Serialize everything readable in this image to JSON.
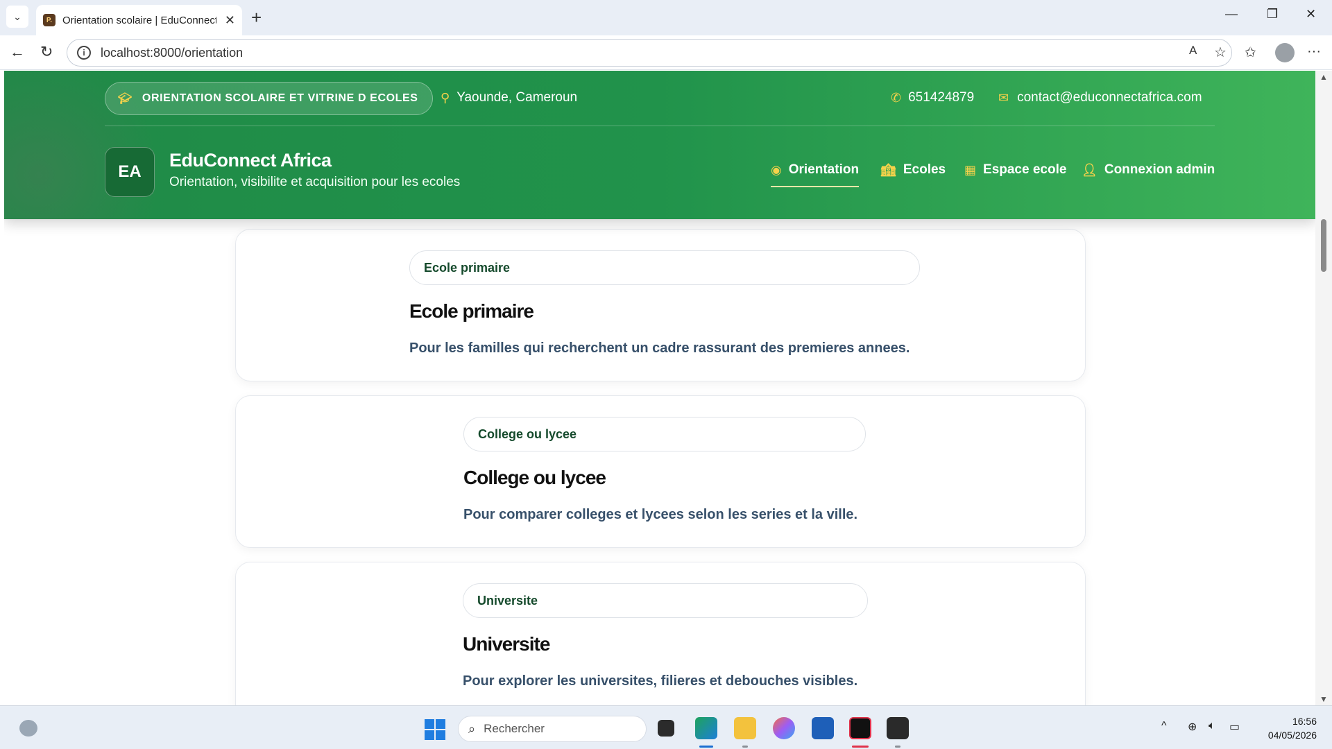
{
  "browser": {
    "tab_title": "Orientation scolaire | EduConnect",
    "favicon_text": "P.",
    "url": "localhost:8000/orientation"
  },
  "header": {
    "pill_label": "ORIENTATION SCOLAIRE ET VITRINE D ECOLES",
    "location": "Yaounde, Cameroun",
    "phone": "651424879",
    "email": "contact@educonnectafrica.com",
    "logo_text": "EA",
    "brand_name": "EduConnect Africa",
    "brand_tagline": "Orientation, visibilite et acquisition pour les ecoles",
    "nav": [
      {
        "label": "Orientation",
        "active": true
      },
      {
        "label": "Ecoles",
        "active": false
      },
      {
        "label": "Espace ecole",
        "active": false
      },
      {
        "label": "Connexion admin",
        "active": false
      }
    ]
  },
  "cards": [
    {
      "chip": "Ecole primaire",
      "title": "Ecole primaire",
      "description": "Pour les familles qui recherchent un cadre rassurant des premieres annees."
    },
    {
      "chip": "College ou lycee",
      "title": "College ou lycee",
      "description": "Pour comparer colleges et lycees selon les series et la ville."
    },
    {
      "chip": "Universite",
      "title": "Universite",
      "description": "Pour explorer les universites, filieres et debouches visibles."
    }
  ],
  "taskbar": {
    "search_placeholder": "Rechercher",
    "time": "16:56",
    "date": "04/05/2026"
  },
  "colors": {
    "header_green": "#21934b",
    "accent_yellow": "#f5d24b",
    "chip_text": "#154a2c",
    "desc_text": "#37506a"
  }
}
